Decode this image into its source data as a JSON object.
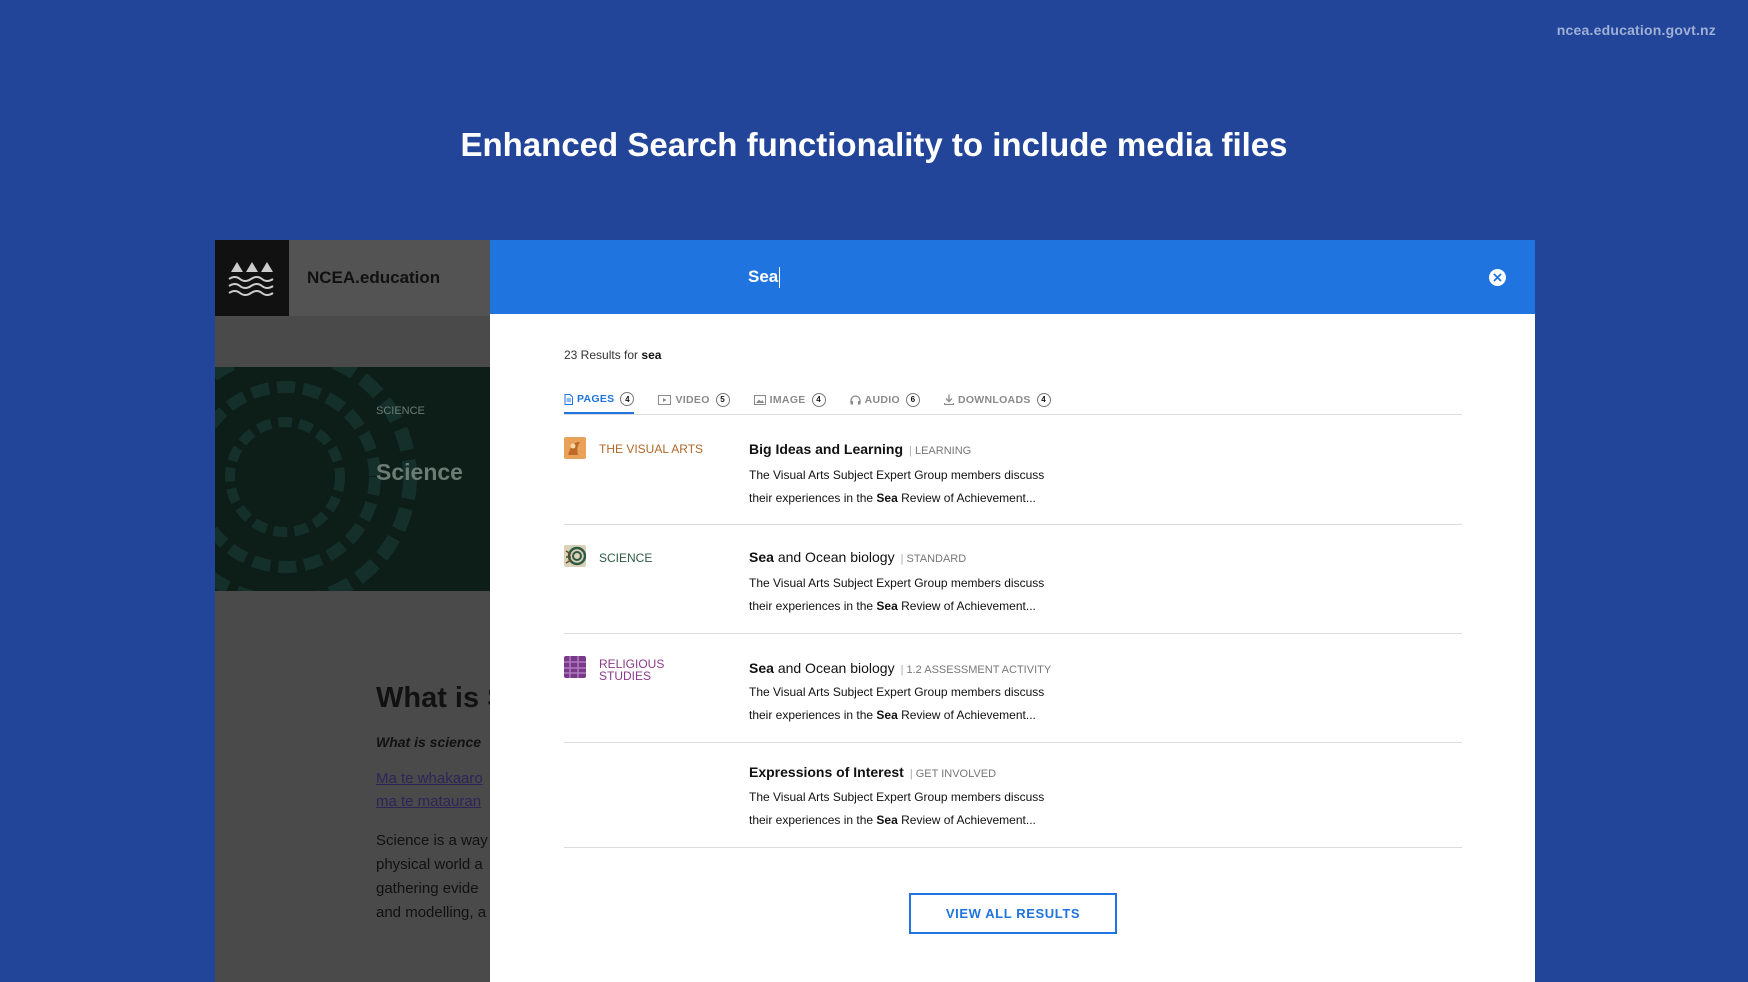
{
  "site_url": "ncea.education.govt.nz",
  "slide_title": "Enhanced Search functionality to include media files",
  "background_site": {
    "brand": "NCEA.education",
    "breadcrumb": "SCIENCE",
    "hero_title": "Science",
    "heading": "What is S",
    "subheading": "What is science",
    "link_line1": "Ma te whakaaro",
    "link_line2": "ma te matauran",
    "body_lines": [
      "Science is a way",
      "physical world a",
      "gathering evide",
      "and modelling, a"
    ]
  },
  "search": {
    "query": "Sea",
    "summary_prefix": "23 Results for",
    "summary_term": "sea"
  },
  "tabs": [
    {
      "label": "PAGES",
      "count": "4",
      "icon": "page-icon",
      "active": true
    },
    {
      "label": "VIDEO",
      "count": "5",
      "icon": "video-icon",
      "active": false
    },
    {
      "label": "IMAGE",
      "count": "4",
      "icon": "image-icon",
      "active": false
    },
    {
      "label": "AUDIO",
      "count": "6",
      "icon": "headphones-icon",
      "active": false
    },
    {
      "label": "DOWNLOADS",
      "count": "4",
      "icon": "download-icon",
      "active": false
    }
  ],
  "results": [
    {
      "subject": "THE VISUAL ARTS",
      "subject_color": "#b0682a",
      "subject_icon": "visual-arts-icon",
      "title_bold": "",
      "title_rest": "Big Ideas and Learning",
      "type": "LEARNING",
      "snippet_line1": "The Visual Arts Subject Expert Group members discuss",
      "snippet_pre": "their experiences in the",
      "snippet_bold": "Sea",
      "snippet_post": "Review of Achievement..."
    },
    {
      "subject": "SCIENCE",
      "subject_color": "#2f5a45",
      "subject_icon": "science-icon",
      "title_bold": "Sea",
      "title_rest": "and Ocean biology",
      "type": "STANDARD",
      "snippet_line1": "The Visual Arts Subject Expert Group members discuss",
      "snippet_pre": "their experiences in the",
      "snippet_bold": "Sea",
      "snippet_post": "Review of Achievement..."
    },
    {
      "subject": "RELIGIOUS STUDIES",
      "subject_color": "#8a3a8c",
      "subject_icon": "religious-studies-icon",
      "title_bold": "Sea",
      "title_rest": "and Ocean biology",
      "type": "1.2 ASSESSMENT ACTIVITY",
      "snippet_line1": "The Visual Arts Subject Expert Group members discuss",
      "snippet_pre": "their experiences in the",
      "snippet_bold": "Sea",
      "snippet_post": "Review of Achievement..."
    },
    {
      "subject": "",
      "subject_color": "",
      "subject_icon": "",
      "title_bold": "",
      "title_rest": "Expressions of Interest",
      "type": "GET INVOLVED",
      "snippet_line1": "The Visual Arts Subject Expert Group members discuss",
      "snippet_pre": "their experiences in the",
      "snippet_bold": "Sea",
      "snippet_post": "Review of Achievement..."
    }
  ],
  "view_all_label": "VIEW ALL RESULTS",
  "colors": {
    "slide_bg": "#22459a",
    "accent": "#1f74e0",
    "dim_site": "#4a4a4a"
  }
}
